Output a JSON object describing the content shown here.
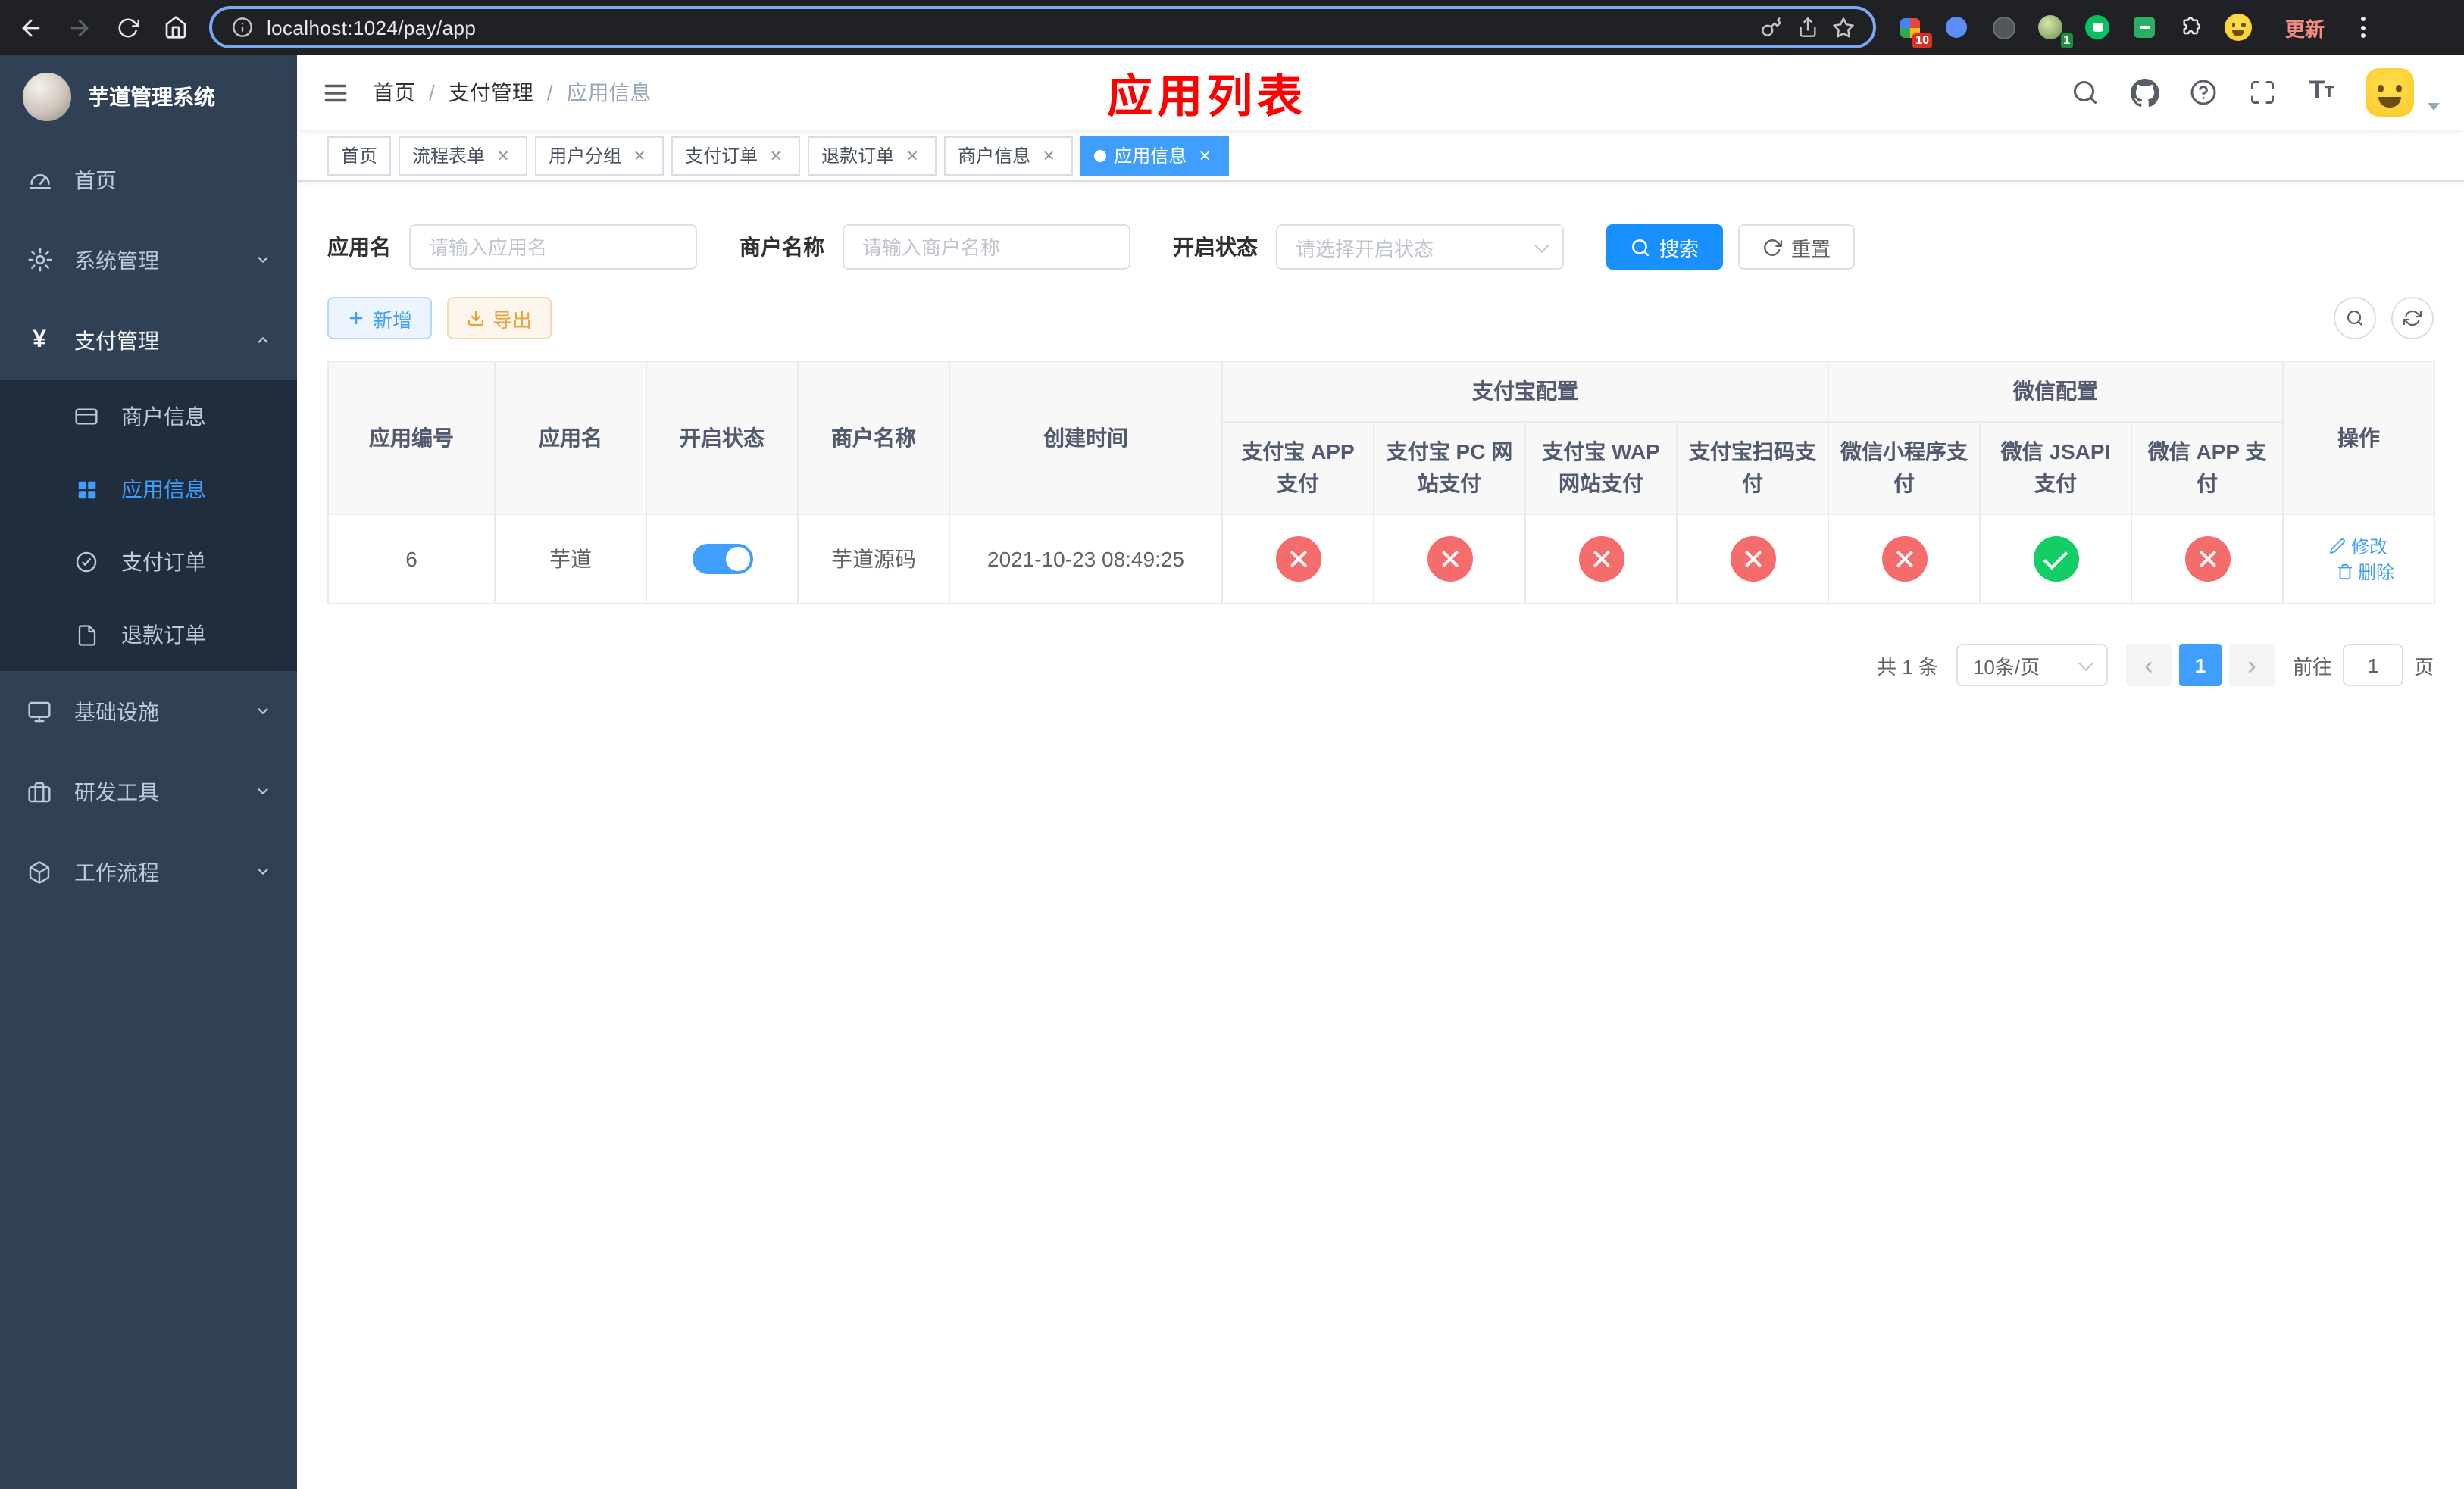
{
  "theme": {
    "accent_blue": "#409eff",
    "button_blue": "#1890ff",
    "danger_red": "#f56c6c",
    "success_green": "#13ce66",
    "sidebar_bg": "#304156",
    "submenu_bg": "#1f2d3d",
    "title_red": "#ff0000"
  },
  "browser": {
    "url": "localhost:1024/pay/app",
    "update_label": "更新",
    "ext_badge_blocker": "10",
    "ext_badge_avatar": "1"
  },
  "sidebar": {
    "title": "芋道管理系统",
    "items": [
      {
        "label": "首页"
      },
      {
        "label": "系统管理"
      },
      {
        "label": "支付管理"
      },
      {
        "label": "基础设施"
      },
      {
        "label": "研发工具"
      },
      {
        "label": "工作流程"
      }
    ],
    "payment_children": [
      {
        "label": "商户信息"
      },
      {
        "label": "应用信息"
      },
      {
        "label": "支付订单"
      },
      {
        "label": "退款订单"
      }
    ]
  },
  "header": {
    "breadcrumb": [
      "首页",
      "支付管理",
      "应用信息"
    ],
    "page_title": "应用列表"
  },
  "tabs": [
    {
      "label": "首页"
    },
    {
      "label": "流程表单"
    },
    {
      "label": "用户分组"
    },
    {
      "label": "支付订单"
    },
    {
      "label": "退款订单"
    },
    {
      "label": "商户信息"
    },
    {
      "label": "应用信息"
    }
  ],
  "filters": {
    "app_name": {
      "label": "应用名",
      "placeholder": "请输入应用名"
    },
    "merchant_name": {
      "label": "商户名称",
      "placeholder": "请输入商户名称"
    },
    "status": {
      "label": "开启状态",
      "placeholder": "请选择开启状态"
    },
    "search_label": "搜索",
    "reset_label": "重置"
  },
  "toolbar": {
    "add_label": "新增",
    "export_label": "导出"
  },
  "table": {
    "columns": {
      "app_id": "应用编号",
      "app_name": "应用名",
      "status": "开启状态",
      "merchant": "商户名称",
      "created": "创建时间",
      "alipay_group": "支付宝配置",
      "alipay_app": "支付宝 APP 支付",
      "alipay_pc": "支付宝 PC 网站支付",
      "alipay_wap": "支付宝 WAP 网站支付",
      "alipay_qr": "支付宝扫码支付",
      "wx_group": "微信配置",
      "wx_mini": "微信小程序支付",
      "wx_jsapi": "微信 JSAPI 支付",
      "wx_app": "微信 APP 支付",
      "actions": "操作"
    },
    "rows": [
      {
        "app_id": "6",
        "app_name": "芋道",
        "enabled": true,
        "merchant": "芋道源码",
        "created": "2021-10-23 08:49:25",
        "channels": {
          "alipay_app": false,
          "alipay_pc": false,
          "alipay_wap": false,
          "alipay_qr": false,
          "wx_mini": false,
          "wx_jsapi": true,
          "wx_app": false
        },
        "edit_label": "修改",
        "delete_label": "删除"
      }
    ]
  },
  "pagination": {
    "total_label": "共 1 条",
    "page_size_label": "10条/页",
    "current_page": "1",
    "goto_label": "前往",
    "goto_value": "1",
    "goto_unit": "页"
  }
}
